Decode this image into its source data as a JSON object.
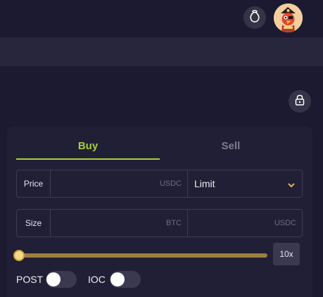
{
  "header": {
    "wallet_icon": "wallet-bag-icon",
    "avatar_icon": "pirate-parrot-avatar"
  },
  "toolbar": {
    "lock_icon": "lock-icon"
  },
  "order_panel": {
    "tabs": [
      {
        "label": "Buy",
        "active": true
      },
      {
        "label": "Sell",
        "active": false
      }
    ],
    "price": {
      "label": "Price",
      "unit": "USDC",
      "order_type": "Limit"
    },
    "size": {
      "label": "Size",
      "base_unit": "BTC",
      "quote_unit": "USDC"
    },
    "leverage": {
      "value": "10x",
      "slider_level": 0
    },
    "toggles": [
      {
        "label": "POST",
        "on": false
      },
      {
        "label": "IOC",
        "on": false
      }
    ]
  },
  "colors": {
    "accent_buy": "#a9cc3c",
    "slider": "#9c7f3d",
    "background": "#1b1a30"
  }
}
